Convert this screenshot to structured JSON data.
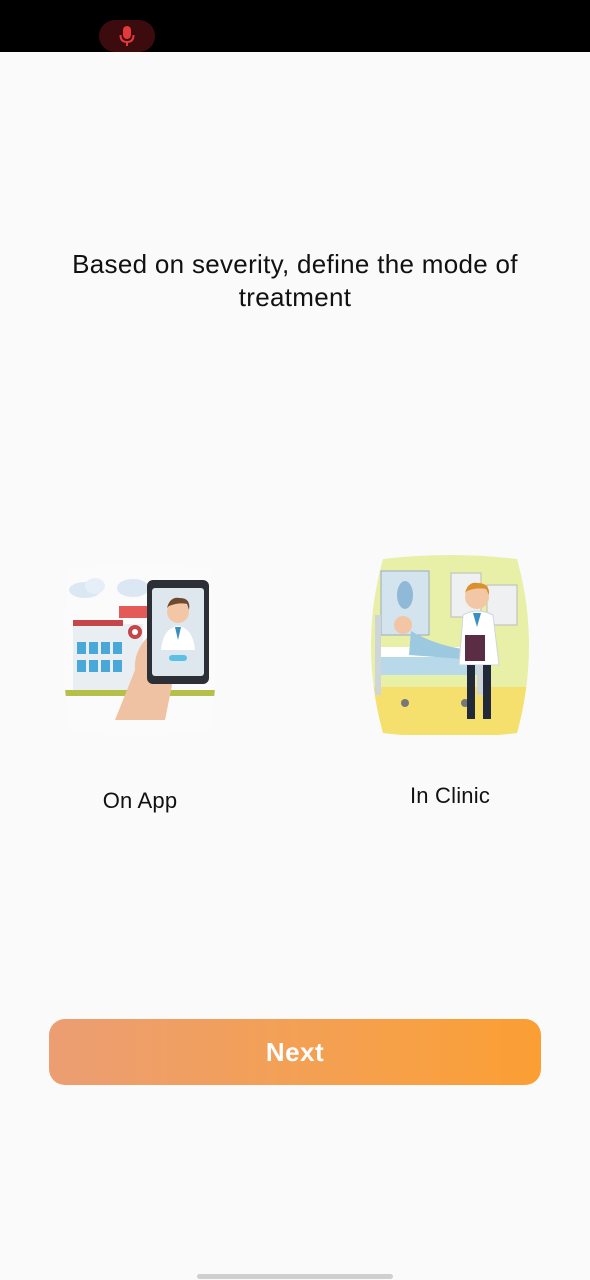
{
  "status_bar": {
    "mic_icon": "microphone-icon",
    "mic_color": "#e23a3a"
  },
  "heading": "Based on severity, define the mode of treatment",
  "options": [
    {
      "label": "On App",
      "illustration": "doctor-on-phone-illustration"
    },
    {
      "label": "In Clinic",
      "illustration": "doctor-in-clinic-illustration"
    }
  ],
  "next_button": {
    "label": "Next",
    "gradient_start": "#ec9e73",
    "gradient_end": "#fb9f33"
  }
}
